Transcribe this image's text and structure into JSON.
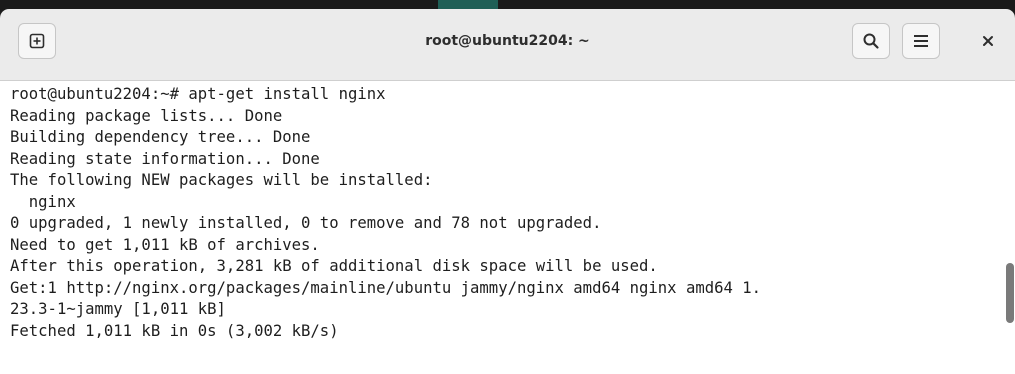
{
  "window": {
    "title": "root@ubuntu2204: ~"
  },
  "headerbar": {
    "new_tab_icon": "plus-square-icon",
    "search_icon": "search-icon",
    "menu_icon": "hamburger-menu-icon",
    "close_label": "×"
  },
  "terminal": {
    "lines": [
      "root@ubuntu2204:~# apt-get install nginx",
      "Reading package lists... Done",
      "Building dependency tree... Done",
      "Reading state information... Done",
      "The following NEW packages will be installed:",
      "  nginx",
      "0 upgraded, 1 newly installed, 0 to remove and 78 not upgraded.",
      "Need to get 1,011 kB of archives.",
      "After this operation, 3,281 kB of additional disk space will be used.",
      "Get:1 http://nginx.org/packages/mainline/ubuntu jammy/nginx amd64 nginx amd64 1.",
      "23.3-1~jammy [1,011 kB]",
      "Fetched 1,011 kB in 0s (3,002 kB/s)"
    ]
  },
  "colors": {
    "headerbar_bg": "#ebebeb",
    "terminal_bg": "#ffffff",
    "terminal_fg": "#1e1e1e",
    "scroll_thumb": "#7a7a7a"
  }
}
